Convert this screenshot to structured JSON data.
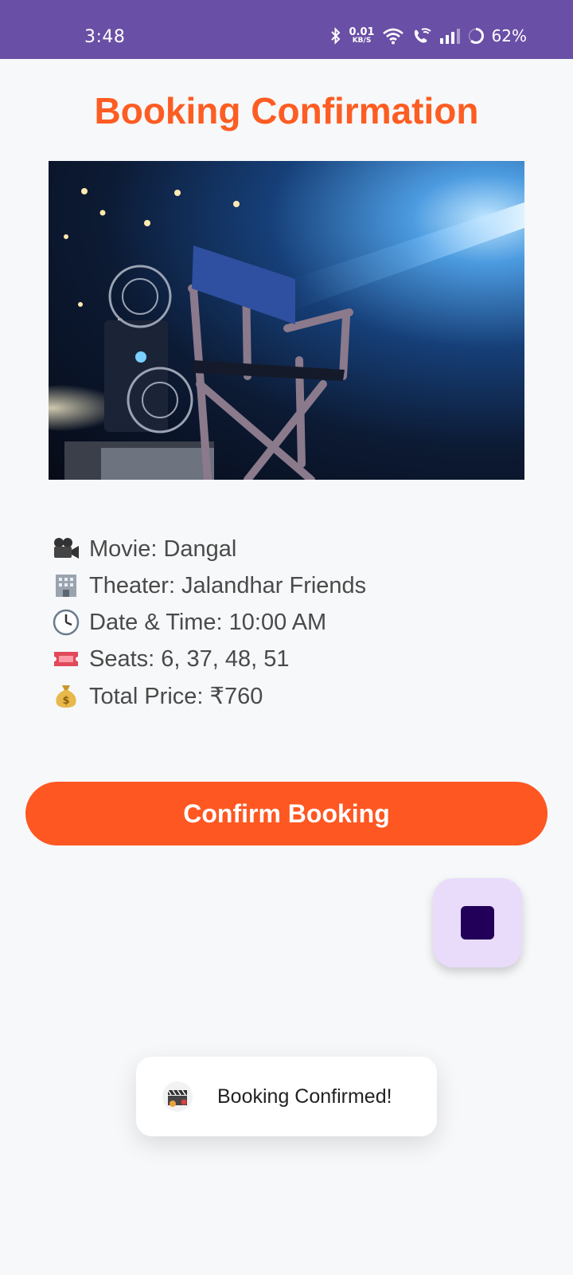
{
  "status_bar": {
    "time": "3:48",
    "net_speed_value": "0.01",
    "net_speed_unit": "KB/S",
    "battery": "62%"
  },
  "page": {
    "title": "Booking Confirmation"
  },
  "details": [
    {
      "icon": "movie-camera-icon",
      "text": "Movie: Dangal"
    },
    {
      "icon": "building-icon",
      "text": "Theater: Jalandhar Friends"
    },
    {
      "icon": "clock-icon",
      "text": "Date & Time: 10:00 AM"
    },
    {
      "icon": "ticket-icon",
      "text": "Seats: 6, 37, 48, 51"
    },
    {
      "icon": "money-bag-icon",
      "text": "Total Price: ₹760"
    }
  ],
  "actions": {
    "confirm_label": "Confirm Booking"
  },
  "toast": {
    "message": "Booking Confirmed!"
  },
  "colors": {
    "status_bar": "#6a4fa6",
    "accent": "#fe5722",
    "fab_background": "#e9dcfb",
    "fab_icon": "#22005a"
  }
}
